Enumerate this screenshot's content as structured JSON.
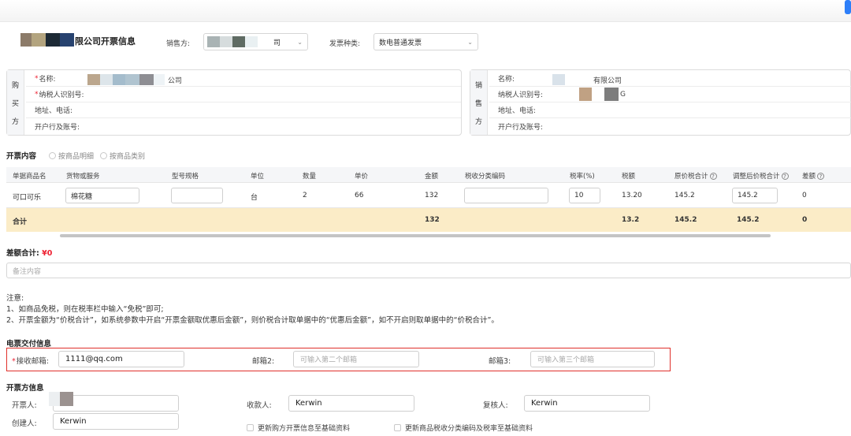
{
  "header": {
    "title": "限公司开票信息",
    "seller_label": "销售方:",
    "seller_value": "司",
    "invoice_type_label": "发票种类:",
    "invoice_type_value": "数电普通发票"
  },
  "buyer": {
    "side_chars": [
      "购",
      "买",
      "方"
    ],
    "name_label": "名称:",
    "name_value": "公司",
    "tax_id_label": "纳税人识别号:",
    "address_label": "地址、电话:",
    "bank_label": "开户行及账号:"
  },
  "seller": {
    "side_chars": [
      "销",
      "售",
      "方"
    ],
    "name_label": "名称:",
    "name_value": "有限公司",
    "tax_id_label": "纳税人识别号:",
    "tax_id_value": "G",
    "address_label": "地址、电话:",
    "bank_label": "开户行及账号:"
  },
  "content": {
    "title": "开票内容",
    "radio_detail": "按商品明细",
    "radio_category": "按商品类别"
  },
  "table": {
    "headers": [
      "单据商品名",
      "货物或服务",
      "型号规格",
      "单位",
      "数量",
      "单价",
      "金额",
      "税收分类编码",
      "税率(%)",
      "税额",
      "原价税合计",
      "调整后价税合计",
      "差额"
    ],
    "row": {
      "name": "可口可乐",
      "goods": "棉花糖",
      "model": "",
      "unit": "台",
      "qty": "2",
      "price": "66",
      "amount": "132",
      "tax_code": "",
      "tax_rate": "10",
      "tax": "13.20",
      "orig_total": "145.2",
      "adj_total": "145.2",
      "diff": "0"
    },
    "total": {
      "label": "合计",
      "amount": "132",
      "tax": "13.2",
      "orig_total": "145.2",
      "adj_total": "145.2",
      "diff": "0"
    }
  },
  "diff_total": {
    "label": "差额合计:",
    "value": "¥0"
  },
  "remark_placeholder": "备注内容",
  "notes": {
    "title": "注意:",
    "line1": "1、如商品免税，则在税率栏中输入“免税”即可;",
    "line2": "2、开票金额为“价税合计”，如系统参数中开启“开票金额取优惠后金额”，则价税合计取单据中的“优惠后金额”，如不开启则取单据中的“价税合计”。"
  },
  "delivery": {
    "title": "电票交付信息",
    "email1_label": "接收邮箱:",
    "email1_value": "1111@qq.com",
    "email2_label": "邮箱2:",
    "email2_placeholder": "可输入第二个邮箱",
    "email3_label": "邮箱3:",
    "email3_placeholder": "可输入第三个邮箱"
  },
  "issuer": {
    "title": "开票方信息",
    "drawer_label": "开票人:",
    "receiver_label": "收款人:",
    "receiver_value": "Kerwin",
    "reviewer_label": "复核人:",
    "reviewer_value": "Kerwin",
    "creator_label": "创建人:",
    "creator_value": "Kerwin",
    "check1": "更新购方开票信息至基础资料",
    "check2": "更新商品税收分类编码及税率至基础资料"
  },
  "colors": {
    "accent_blue": "#2d7ff9",
    "required_red": "#e23",
    "highlight_border": "#e0302b",
    "total_row_bg": "#fbecc7"
  }
}
